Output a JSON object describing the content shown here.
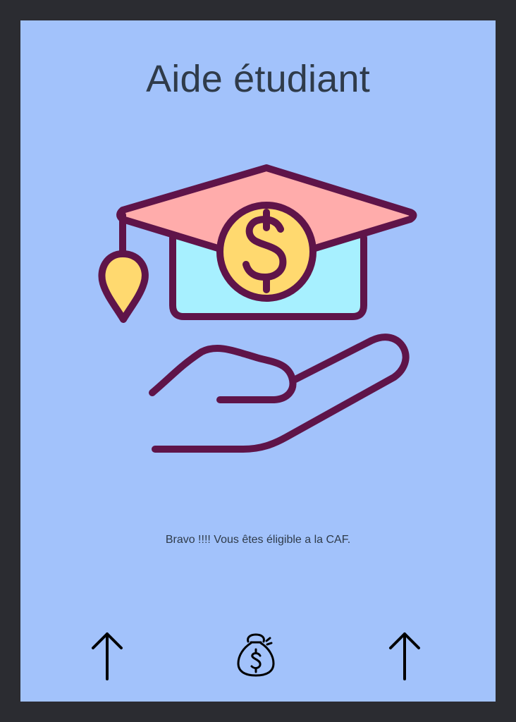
{
  "app": {
    "title": "Aide étudiant"
  },
  "main": {
    "message": "Bravo !!!! Vous êtes éligible a la CAF."
  },
  "icons": {
    "hero": "graduation-cap-money-hand-icon",
    "left_nav": "arrow-up-icon",
    "center_nav": "money-bag-icon",
    "right_nav": "arrow-up-icon"
  },
  "colors": {
    "background": "#a2c2fb",
    "frame": "#2b2c31",
    "title": "#2f3b4a",
    "icon_outline": "#5f1449",
    "cap_top": "#ffacab",
    "cap_base": "#a7f0ff",
    "coin": "#ffd96f"
  }
}
